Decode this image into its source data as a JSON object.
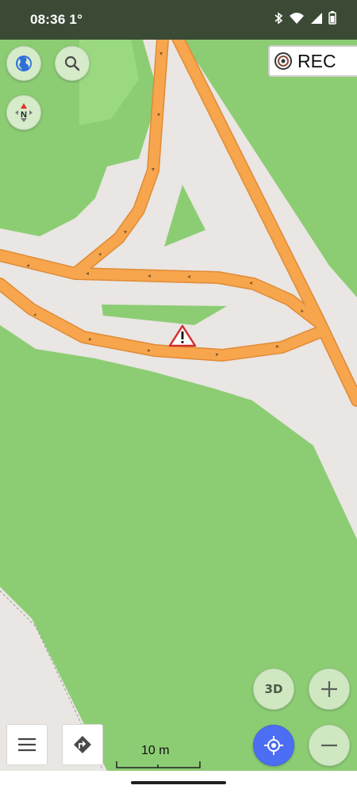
{
  "status_bar": {
    "time": "08:36",
    "temperature": "1°",
    "icons": [
      "bluetooth-icon",
      "wifi-icon",
      "signal-icon",
      "battery-icon"
    ]
  },
  "map_controls": {
    "layers_icon": "globe-icon",
    "search_icon": "search-icon",
    "compass_icon": "compass-north-icon",
    "compass_label": "N",
    "rec_label": "REC",
    "rec_icon": "target-icon",
    "view_3d_label": "3D",
    "zoom_in_icon": "plus-icon",
    "zoom_out_icon": "minus-icon",
    "my_location_icon": "crosshair-icon",
    "menu_icon": "hamburger-icon",
    "route_icon": "turn-right-icon"
  },
  "scale_bar": {
    "label": "10 m"
  },
  "map": {
    "warning_icon": "warning-triangle-icon",
    "colors": {
      "background": "#e9e6e3",
      "grass": "#8ccd74",
      "grass_light": "#9bd981",
      "road": "#f7a64d",
      "road_edge": "#e08a35",
      "status_bar": "#3b4a34",
      "accent_blue": "#4b6ef5"
    }
  }
}
